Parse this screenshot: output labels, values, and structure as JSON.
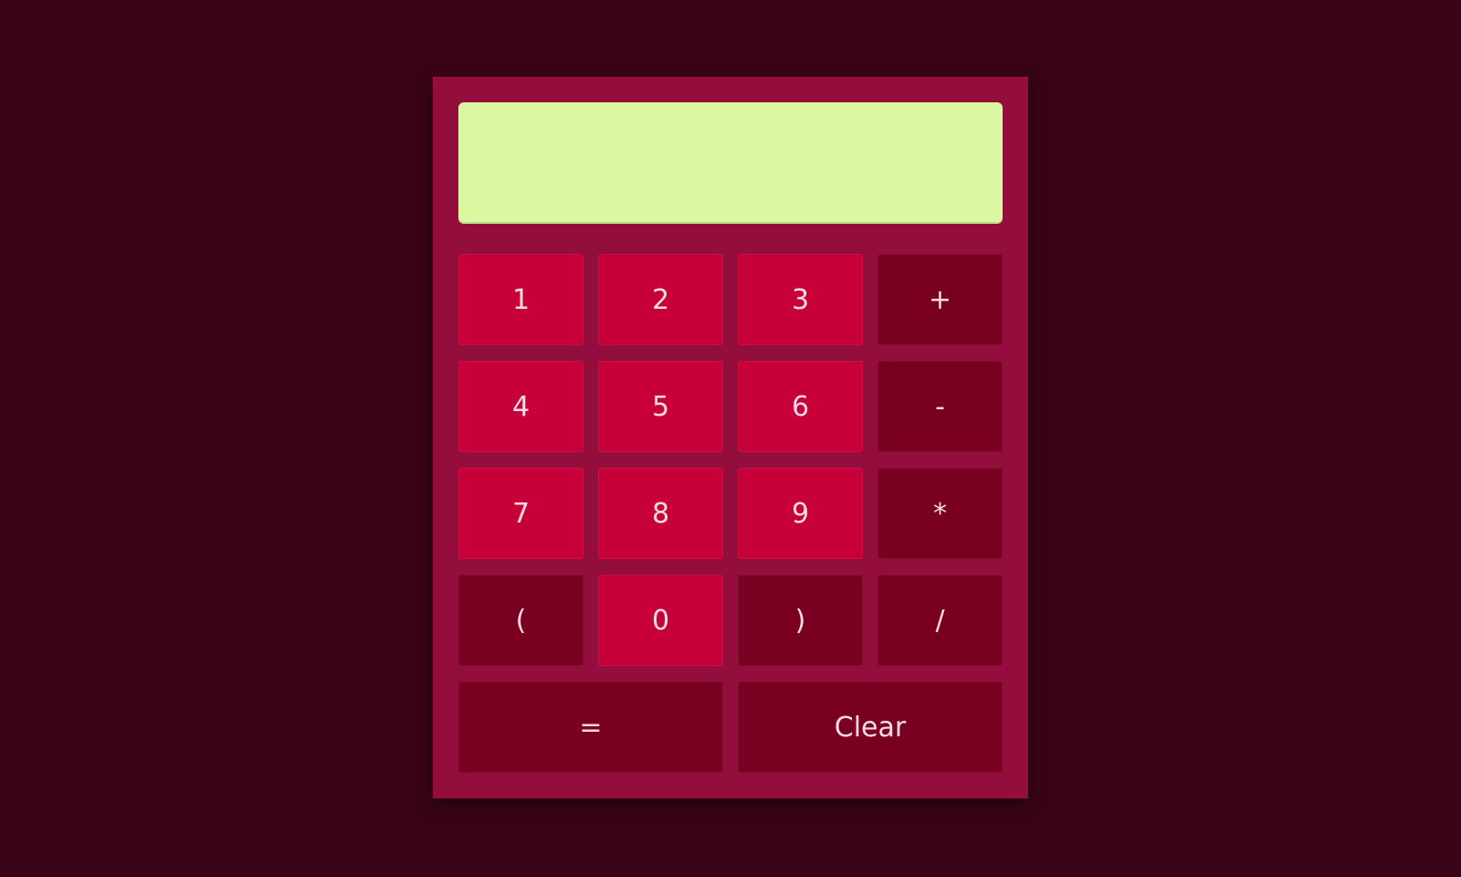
{
  "display": {
    "value": ""
  },
  "keys": [
    {
      "label": "1",
      "kind": "num"
    },
    {
      "label": "2",
      "kind": "num"
    },
    {
      "label": "3",
      "kind": "num"
    },
    {
      "label": "+",
      "kind": "op"
    },
    {
      "label": "4",
      "kind": "num"
    },
    {
      "label": "5",
      "kind": "num"
    },
    {
      "label": "6",
      "kind": "num"
    },
    {
      "label": "-",
      "kind": "op"
    },
    {
      "label": "7",
      "kind": "num"
    },
    {
      "label": "8",
      "kind": "num"
    },
    {
      "label": "9",
      "kind": "num"
    },
    {
      "label": "*",
      "kind": "op"
    },
    {
      "label": "(",
      "kind": "op"
    },
    {
      "label": "0",
      "kind": "num"
    },
    {
      "label": ")",
      "kind": "op"
    },
    {
      "label": "/",
      "kind": "op"
    },
    {
      "label": "=",
      "kind": "op"
    },
    {
      "label": "Clear",
      "kind": "op"
    }
  ],
  "colors": {
    "page_background": "#3a0418",
    "calculator_body": "#930d3d",
    "display_background": "#dcf7a2",
    "number_key": "#c70039",
    "operator_key": "#7a0022",
    "key_text": "#f6dbe5"
  }
}
